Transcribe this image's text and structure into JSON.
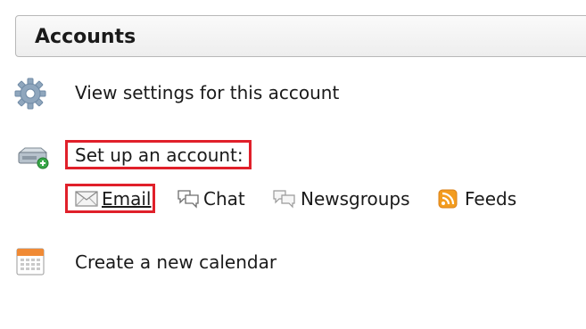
{
  "header": {
    "title": "Accounts"
  },
  "actions": {
    "view_settings": {
      "label": "View settings for this account",
      "icon": "gear-icon"
    },
    "setup_account": {
      "label": "Set up an account:",
      "icon": "add-account-icon"
    },
    "create_calendar": {
      "label": "Create a new calendar",
      "icon": "calendar-icon"
    }
  },
  "account_types": [
    {
      "label": "Email",
      "icon": "envelope-icon"
    },
    {
      "label": "Chat",
      "icon": "chat-icon"
    },
    {
      "label": "Newsgroups",
      "icon": "newsgroups-icon"
    },
    {
      "label": "Feeds",
      "icon": "rss-icon"
    }
  ],
  "colors": {
    "highlight": "#e0202a",
    "feeds_orange": "#f39c1e",
    "calendar_orange": "#f08a35"
  }
}
